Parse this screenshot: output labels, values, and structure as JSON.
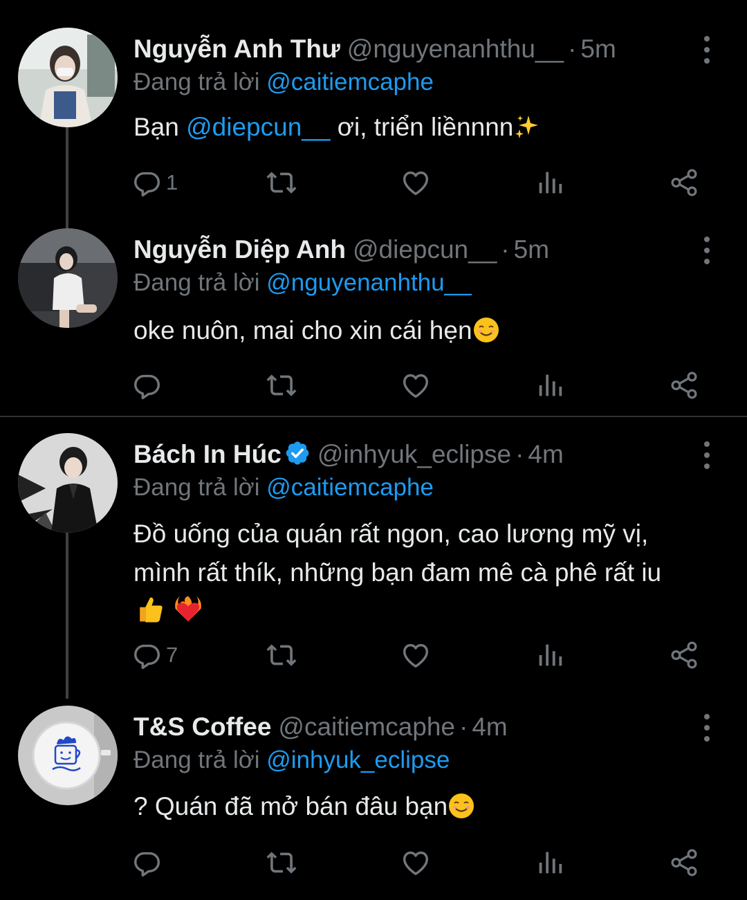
{
  "tweets": [
    {
      "name": "Nguyễn Anh Thư",
      "handle": "@nguyenanhthu__",
      "dot": "·",
      "time": "5m",
      "replying_prefix": "Đang trả lời",
      "replying_to": "@caitiemcaphe",
      "body": {
        "part1": "Bạn ",
        "mention": "@diepcun__",
        "part2": " ơi, triển liềnnnn"
      },
      "reply_count": "1"
    },
    {
      "name": "Nguyễn Diệp Anh",
      "handle": "@diepcun__",
      "dot": "·",
      "time": "5m",
      "replying_prefix": "Đang trả lời",
      "replying_to": "@nguyenanhthu__",
      "body": {
        "text": "oke nuôn, mai cho xin cái hẹn"
      },
      "reply_count": ""
    },
    {
      "name": "Bách In Húc",
      "handle": "@inhyuk_eclipse",
      "dot": "·",
      "time": "4m",
      "replying_prefix": "Đang trả lời",
      "replying_to": "@caitiemcaphe",
      "verified": true,
      "body": {
        "line1": "Đồ uống của quán rất ngon, cao lương mỹ vị,",
        "line2": "mình rất thík, những bạn đam mê cà phê rất iu"
      },
      "reply_count": "7"
    },
    {
      "name": "T&S Coffee",
      "handle": "@caitiemcaphe",
      "dot": "·",
      "time": "4m",
      "replying_prefix": "Đang trả lời",
      "replying_to": "@inhyuk_eclipse",
      "body": {
        "text": "? Quán đã mở bán đâu bạn"
      },
      "reply_count": ""
    }
  ],
  "icons": {
    "reply": "reply-icon",
    "retweet": "retweet-icon",
    "like": "heart-icon",
    "views": "views-icon",
    "share": "share-icon",
    "more": "more-vertical-icon",
    "verified": "verified-badge-icon"
  },
  "colors": {
    "background": "#000000",
    "text": "#e7e9ea",
    "muted": "#71767b",
    "accent": "#1d9bf0",
    "thread_line": "#3e4144"
  }
}
